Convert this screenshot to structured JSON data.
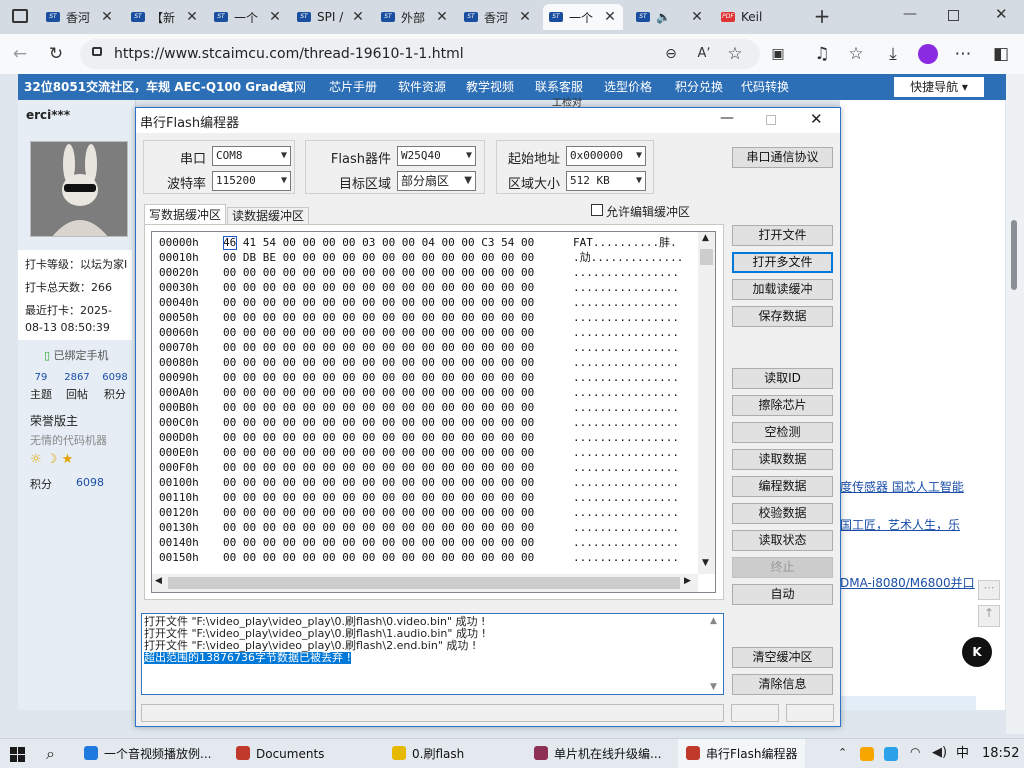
{
  "browser": {
    "tabs": [
      {
        "label": "香河",
        "fav": "ST"
      },
      {
        "label": "【新",
        "fav": "ST"
      },
      {
        "label": "一个",
        "fav": "ST"
      },
      {
        "label": "SPI /",
        "fav": "ST"
      },
      {
        "label": "外部",
        "fav": "ST"
      },
      {
        "label": "香河",
        "fav": "ST"
      },
      {
        "label": "一个",
        "fav": "ST",
        "active": true
      },
      {
        "label": "",
        "fav": "ST"
      },
      {
        "label": "Keil",
        "fav": "PDF"
      }
    ],
    "url": "https://www.stcaimcu.com/thread-19610-1-1.html"
  },
  "site": {
    "brand": "32位8051交流社区，车规 AEC-Q100 Grade1",
    "nav": [
      "官网",
      "芯片手册",
      "软件资源",
      "教学视频",
      "联系客服",
      "选型价格",
      "积分兑换",
      "代码转换"
    ],
    "quick_nav": "快捷导航",
    "behind_label": "工检对"
  },
  "profile": {
    "username": "erci***",
    "checkin_level": "打卡等级：以坛为家I",
    "checkin_days": "打卡总天数：266",
    "last_checkin": "最近打卡：2025-08-13 08:50:39",
    "phone": "已绑定手机",
    "stats": [
      {
        "v": "79",
        "l": "主题"
      },
      {
        "v": "2867",
        "l": "回帖"
      },
      {
        "v": "6098",
        "l": "积分"
      }
    ],
    "rank": "荣誉版主",
    "title": "无情的代码机器",
    "points_label": "积分",
    "points_value": "6098"
  },
  "page_links": [
    "度传感器 国芯人工智能",
    "国工匠，艺术人生，乐",
    "DMA-i8080/M6800并口"
  ],
  "app": {
    "title": "串行Flash编程器",
    "port_label": "串口",
    "port": "COM8",
    "baud_label": "波特率",
    "baud": "115200",
    "device_label": "Flash器件",
    "device": "W25Q40",
    "region_label": "目标区域",
    "region": "部分扇区",
    "start_label": "起始地址",
    "start": "0x000000",
    "size_label": "区域大小",
    "size": "512 KB",
    "protocol_btn": "串口通信协议",
    "tab_write": "写数据缓冲区",
    "tab_read": "读数据缓冲区",
    "allow_edit": "允许编辑缓冲区",
    "buttons_top": [
      "打开文件",
      "打开多文件",
      "加载读缓冲",
      "保存数据"
    ],
    "buttons_mid": [
      "读取ID",
      "擦除芯片",
      "空检测",
      "读取数据",
      "编程数据",
      "校验数据",
      "读取状态",
      "终止",
      "自动"
    ],
    "buttons_bottom": [
      "清空缓冲区",
      "清除信息"
    ],
    "hex_rows": [
      {
        "addr": "00000h",
        "bytes": "46 41 54 00 00 00 00 03 00 00 04 00 00 C3 54 00",
        "ascii": "FAT..........肨."
      },
      {
        "addr": "00010h",
        "bytes": "00 DB BE 00 00 00 00 00 00 00 00 00 00 00 00 00",
        "ascii": ".劥.............."
      },
      {
        "addr": "00020h",
        "bytes": "00 00 00 00 00 00 00 00 00 00 00 00 00 00 00 00",
        "ascii": "................"
      },
      {
        "addr": "00030h",
        "bytes": "00 00 00 00 00 00 00 00 00 00 00 00 00 00 00 00",
        "ascii": "................"
      },
      {
        "addr": "00040h",
        "bytes": "00 00 00 00 00 00 00 00 00 00 00 00 00 00 00 00",
        "ascii": "................"
      },
      {
        "addr": "00050h",
        "bytes": "00 00 00 00 00 00 00 00 00 00 00 00 00 00 00 00",
        "ascii": "................"
      },
      {
        "addr": "00060h",
        "bytes": "00 00 00 00 00 00 00 00 00 00 00 00 00 00 00 00",
        "ascii": "................"
      },
      {
        "addr": "00070h",
        "bytes": "00 00 00 00 00 00 00 00 00 00 00 00 00 00 00 00",
        "ascii": "................"
      },
      {
        "addr": "00080h",
        "bytes": "00 00 00 00 00 00 00 00 00 00 00 00 00 00 00 00",
        "ascii": "................"
      },
      {
        "addr": "00090h",
        "bytes": "00 00 00 00 00 00 00 00 00 00 00 00 00 00 00 00",
        "ascii": "................"
      },
      {
        "addr": "000A0h",
        "bytes": "00 00 00 00 00 00 00 00 00 00 00 00 00 00 00 00",
        "ascii": "................"
      },
      {
        "addr": "000B0h",
        "bytes": "00 00 00 00 00 00 00 00 00 00 00 00 00 00 00 00",
        "ascii": "................"
      },
      {
        "addr": "000C0h",
        "bytes": "00 00 00 00 00 00 00 00 00 00 00 00 00 00 00 00",
        "ascii": "................"
      },
      {
        "addr": "000D0h",
        "bytes": "00 00 00 00 00 00 00 00 00 00 00 00 00 00 00 00",
        "ascii": "................"
      },
      {
        "addr": "000E0h",
        "bytes": "00 00 00 00 00 00 00 00 00 00 00 00 00 00 00 00",
        "ascii": "................"
      },
      {
        "addr": "000F0h",
        "bytes": "00 00 00 00 00 00 00 00 00 00 00 00 00 00 00 00",
        "ascii": "................"
      },
      {
        "addr": "00100h",
        "bytes": "00 00 00 00 00 00 00 00 00 00 00 00 00 00 00 00",
        "ascii": "................"
      },
      {
        "addr": "00110h",
        "bytes": "00 00 00 00 00 00 00 00 00 00 00 00 00 00 00 00",
        "ascii": "................"
      },
      {
        "addr": "00120h",
        "bytes": "00 00 00 00 00 00 00 00 00 00 00 00 00 00 00 00",
        "ascii": "................"
      },
      {
        "addr": "00130h",
        "bytes": "00 00 00 00 00 00 00 00 00 00 00 00 00 00 00 00",
        "ascii": "................"
      },
      {
        "addr": "00140h",
        "bytes": "00 00 00 00 00 00 00 00 00 00 00 00 00 00 00 00",
        "ascii": "................"
      },
      {
        "addr": "00150h",
        "bytes": "00 00 00 00 00 00 00 00 00 00 00 00 00 00 00 00",
        "ascii": "................"
      }
    ],
    "messages": [
      "打开文件 \"F:\\video_play\\video_play\\0.刷flash\\0.video.bin\" 成功 !",
      "打开文件 \"F:\\video_play\\video_play\\0.刷flash\\1.audio.bin\" 成功 !",
      "打开文件 \"F:\\video_play\\video_play\\0.刷flash\\2.end.bin\" 成功 !",
      "超出范围的13876736字节数据已被丢弃 !"
    ]
  },
  "taskbar": {
    "items": [
      "一个音视频播放例...",
      "Documents",
      "0.刷flash",
      "单片机在线升级编...",
      "串行Flash编程器"
    ],
    "ime": "中",
    "time": "18:52"
  },
  "colors": {
    "accent": "#0078d7",
    "site_blue": "#2d6fb6",
    "link": "#1a4ea8"
  }
}
